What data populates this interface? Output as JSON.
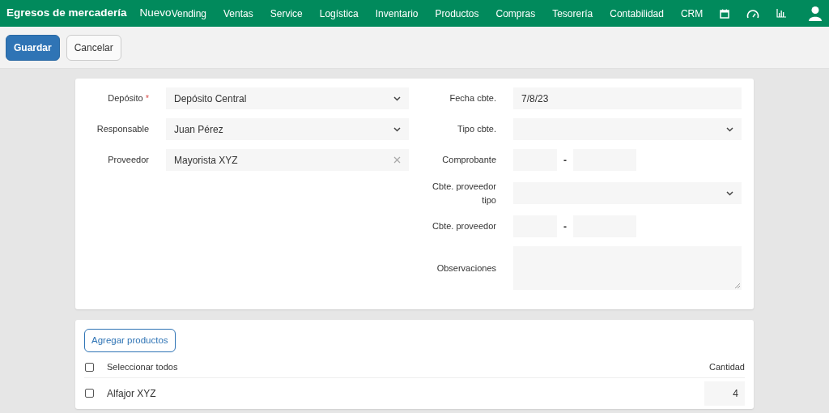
{
  "header": {
    "title": "Egresos de mercadería",
    "subtitle": "Nuevo"
  },
  "nav": [
    "Vending",
    "Ventas",
    "Service",
    "Logística",
    "Inventario",
    "Productos",
    "Compras",
    "Tesorería",
    "Contabilidad",
    "CRM"
  ],
  "toolbar": [
    {
      "label": "Guardar",
      "kind": "primary"
    },
    {
      "label": "Cancelar",
      "kind": "secondary"
    }
  ],
  "left_fields": [
    {
      "label": "Depósito",
      "required_mark": "*",
      "kind": "select",
      "value": "Depósito Central"
    },
    {
      "label": "Responsable",
      "kind": "select",
      "value": "Juan Pérez"
    },
    {
      "label": "Proveedor",
      "kind": "clearable",
      "value": "Mayorista XYZ"
    }
  ],
  "right_fields": [
    {
      "label": "Fecha cbte.",
      "kind": "text",
      "value": "7/8/23"
    },
    {
      "label": "Tipo cbte.",
      "kind": "select"
    },
    {
      "label": "Comprobante",
      "kind": "split",
      "separator": "-"
    },
    {
      "label": "Cbte. proveedor tipo",
      "kind": "select"
    },
    {
      "label": "Cbte. proveedor",
      "kind": "split",
      "separator": "-"
    },
    {
      "label": "Observaciones",
      "kind": "textarea"
    }
  ],
  "products": {
    "add_button": "Agregar productos",
    "select_all": {
      "label": "Seleccionar todos",
      "checked": false
    },
    "quantity_header": "Cantidad",
    "rows": [
      {
        "name": "Alfajor XYZ",
        "checked": false,
        "quantity": "4"
      }
    ]
  }
}
